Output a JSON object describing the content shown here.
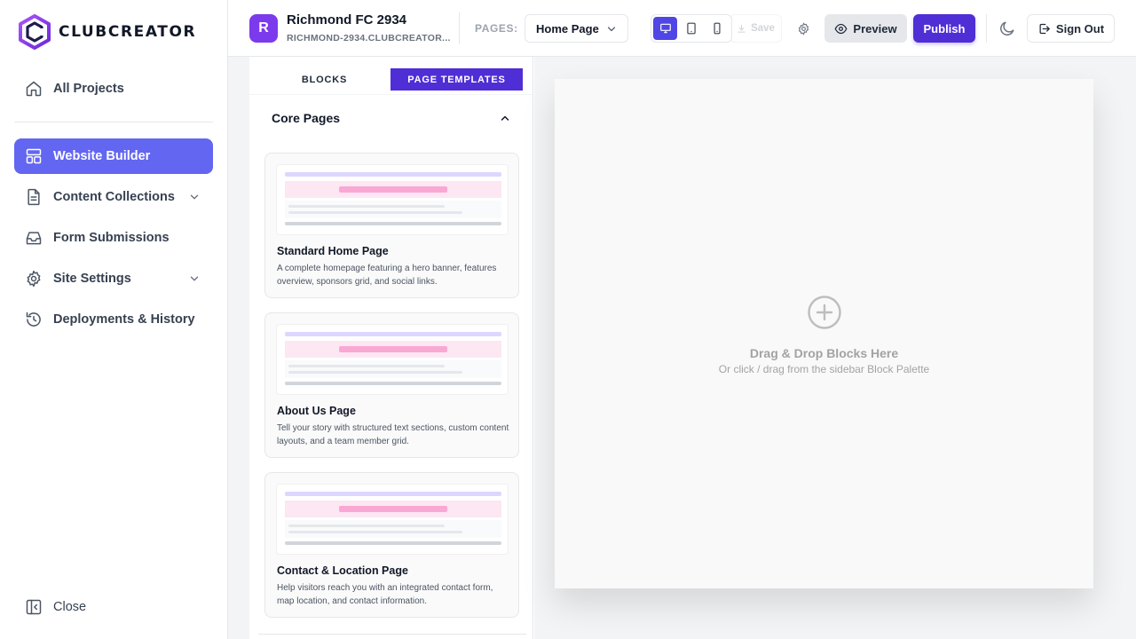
{
  "brand": {
    "name": "CLUBCREATOR",
    "accent": "#6366f1",
    "primary": "#4f2ed6"
  },
  "sidebar": {
    "items": [
      {
        "label": "All Projects",
        "icon": "home-icon"
      },
      {
        "label": "Website Builder",
        "icon": "layout-icon",
        "active": true
      },
      {
        "label": "Content Collections",
        "icon": "document-icon",
        "expandable": true
      },
      {
        "label": "Form Submissions",
        "icon": "inbox-icon"
      },
      {
        "label": "Site Settings",
        "icon": "gear-icon",
        "expandable": true
      },
      {
        "label": "Deployments & History",
        "icon": "history-icon"
      }
    ],
    "close_label": "Close"
  },
  "header": {
    "avatar_letter": "R",
    "project_name": "Richmond FC 2934",
    "project_url": "RICHMOND-2934.CLUBCREATOR...",
    "pages_label": "PAGES:",
    "selected_page": "Home Page",
    "save_label": "Save",
    "preview_label": "Preview",
    "publish_label": "Publish",
    "signout_label": "Sign Out"
  },
  "palette": {
    "tabs": [
      {
        "label": "BLOCKS",
        "active": false
      },
      {
        "label": "PAGE TEMPLATES",
        "active": true
      }
    ],
    "section_title": "Core Pages",
    "templates": [
      {
        "title": "Standard Home Page",
        "description": "A complete homepage featuring a hero banner, features overview, sponsors grid, and social links."
      },
      {
        "title": "About Us Page",
        "description": "Tell your story with structured text sections, custom content layouts, and a team member grid."
      },
      {
        "title": "Contact & Location Page",
        "description": "Help visitors reach you with an integrated contact form, map location, and contact information."
      }
    ]
  },
  "canvas": {
    "drop_title": "Drag & Drop Blocks Here",
    "drop_subtitle": "Or click / drag from the sidebar Block Palette"
  }
}
